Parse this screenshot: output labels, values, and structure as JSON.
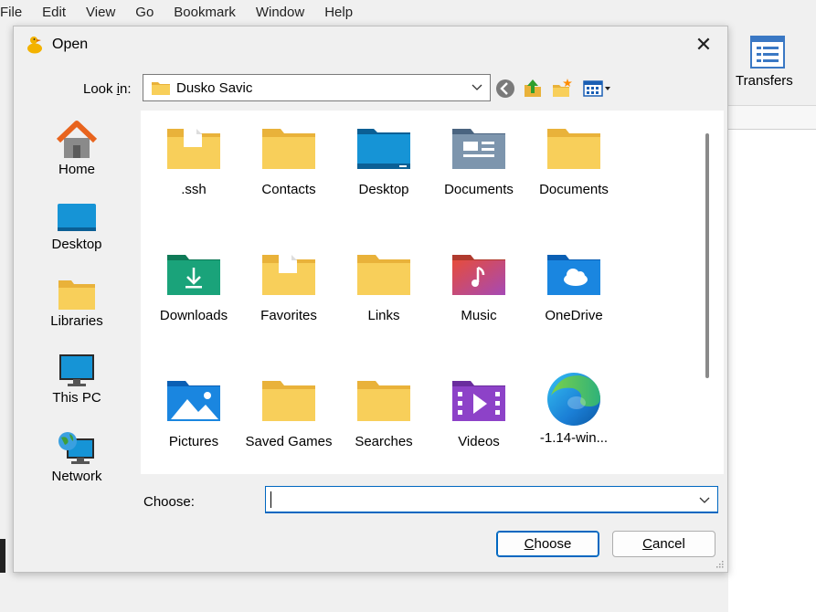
{
  "menubar": {
    "items": [
      "File",
      "Edit",
      "View",
      "Go",
      "Bookmark",
      "Window",
      "Help"
    ]
  },
  "toolbar": {
    "transfers_label": "Transfers"
  },
  "dialog": {
    "title": "Open",
    "close_glyph": "✕",
    "look_in": {
      "label_pre": "Look ",
      "label_acc": "i",
      "label_post": "n:",
      "value": "Dusko Savic"
    },
    "places": [
      "Home",
      "Desktop",
      "Libraries",
      "This PC",
      "Network"
    ],
    "files": [
      {
        "name": ".ssh",
        "icon": "folder-shortcut-icon"
      },
      {
        "name": "Contacts",
        "icon": "folder-icon"
      },
      {
        "name": "Desktop",
        "icon": "desktop-folder-icon"
      },
      {
        "name": "Documents",
        "icon": "documents-folder-icon"
      },
      {
        "name": "Documents",
        "icon": "folder-icon"
      },
      {
        "name": "Downloads",
        "icon": "downloads-folder-icon"
      },
      {
        "name": "Favorites",
        "icon": "folder-shortcut-icon"
      },
      {
        "name": "Links",
        "icon": "folder-icon"
      },
      {
        "name": "Music",
        "icon": "music-folder-icon"
      },
      {
        "name": "OneDrive",
        "icon": "onedrive-folder-icon"
      },
      {
        "name": "Pictures",
        "icon": "pictures-folder-icon"
      },
      {
        "name": "Saved Games",
        "icon": "folder-icon"
      },
      {
        "name": "Searches",
        "icon": "folder-icon"
      },
      {
        "name": "Videos",
        "icon": "videos-folder-icon"
      },
      {
        "name": "-1.14-win...",
        "icon": "edge-icon"
      }
    ],
    "choose_label": "Choose:",
    "choose_value": "",
    "choose_button": {
      "acc": "C",
      "rest": "hoose"
    },
    "cancel_button": {
      "acc": "C",
      "rest": "ancel"
    }
  },
  "colors": {
    "accent": "#0067c0",
    "folder": "#f8cf5a",
    "folder_dark": "#e9b23a"
  }
}
